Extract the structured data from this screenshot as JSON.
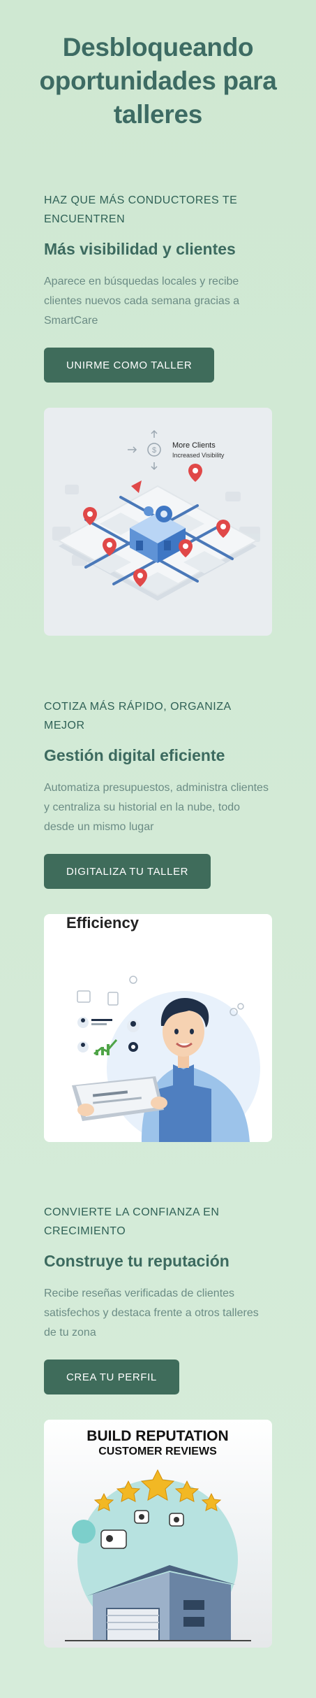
{
  "hero": {
    "title": "Desbloqueando oportunidades para talleres"
  },
  "sections": [
    {
      "eyebrow": "HAZ QUE MÁS CONDUCTORES TE ENCUENTREN",
      "heading": "Más visibilidad y clientes",
      "description": "Aparece en búsquedas locales y recibe clientes nuevos cada semana gracias a SmartCare",
      "cta": "UNIRME COMO TALLER",
      "illustration": {
        "line1": "More Clients",
        "line2": "Increased Visibility"
      }
    },
    {
      "eyebrow": "COTIZA MÁS RÁPIDO, ORGANIZA MEJOR",
      "heading": "Gestión digital eficiente",
      "description": "Automatiza presupuestos, administra clientes y centraliza su historial en la nube, todo desde un mismo lugar",
      "cta": "DIGITALIZA TU TALLER",
      "illustration": {
        "title": "Efficiency"
      }
    },
    {
      "eyebrow": "CONVIERTE LA CONFIANZA EN CRECIMIENTO",
      "heading": "Construye tu reputación",
      "description": "Recibe reseñas verificadas de clientes satisfechos y destaca frente a otros talleres de tu zona",
      "cta": "CREA TU PERFIL",
      "illustration": {
        "title1": "BUILD REPUTATION",
        "title2": "CUSTOMER REVIEWS"
      }
    }
  ],
  "colors": {
    "background": "#d1e9d4",
    "primary": "#3f6c5b",
    "heading": "#3d6b63",
    "muted": "#6b8c85"
  }
}
